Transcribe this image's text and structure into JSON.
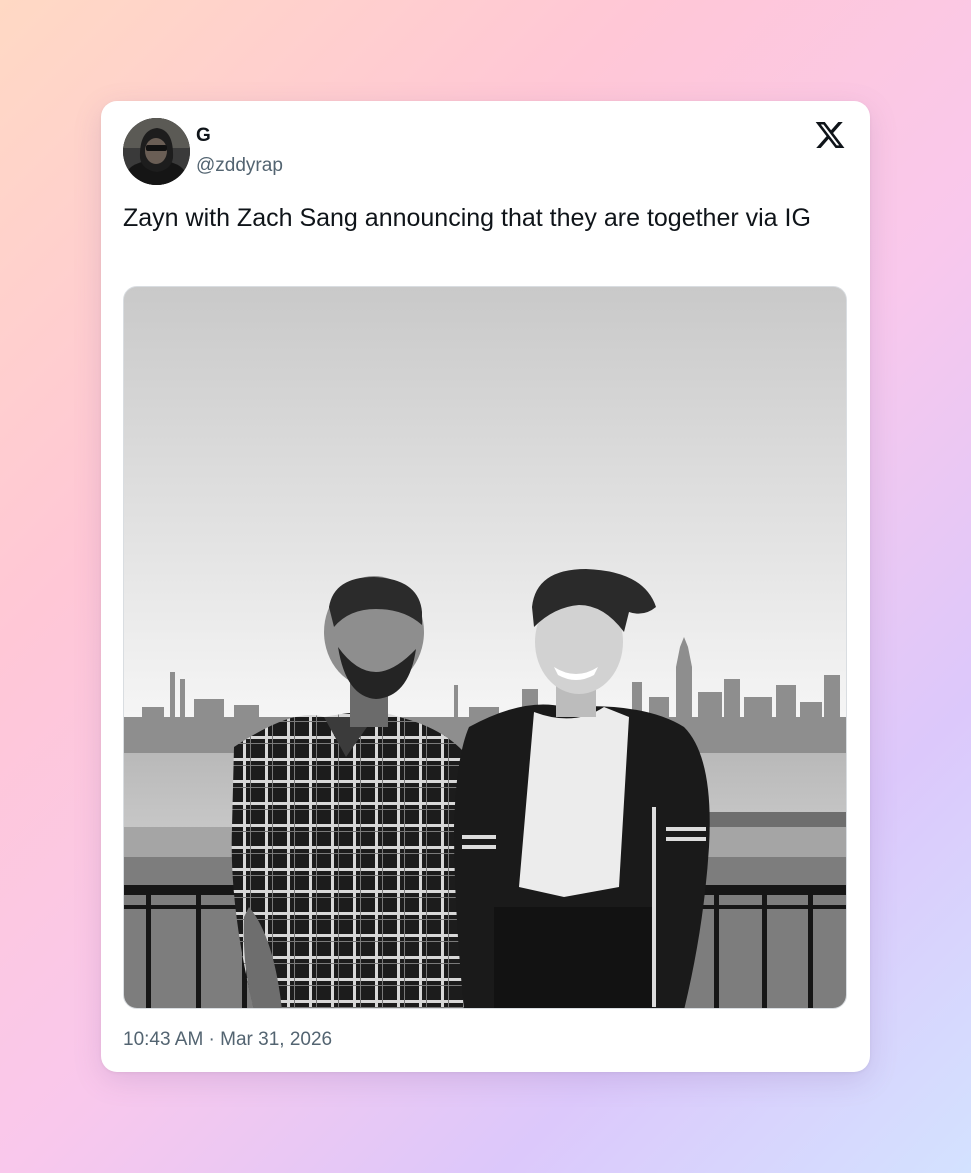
{
  "tweet": {
    "display_name": "G",
    "handle": "@zddyrap",
    "text": "Zayn with Zach Sang announcing that they are together via IG",
    "timestamp": "10:43 AM · Mar 31, 2026"
  },
  "icons": {
    "brand": "x-logo-icon",
    "avatar": "avatar"
  },
  "media": {
    "type": "photo",
    "style": "black-and-white"
  },
  "colors": {
    "text_primary": "#0f1419",
    "text_secondary": "#536471",
    "card_background": "#ffffff"
  }
}
